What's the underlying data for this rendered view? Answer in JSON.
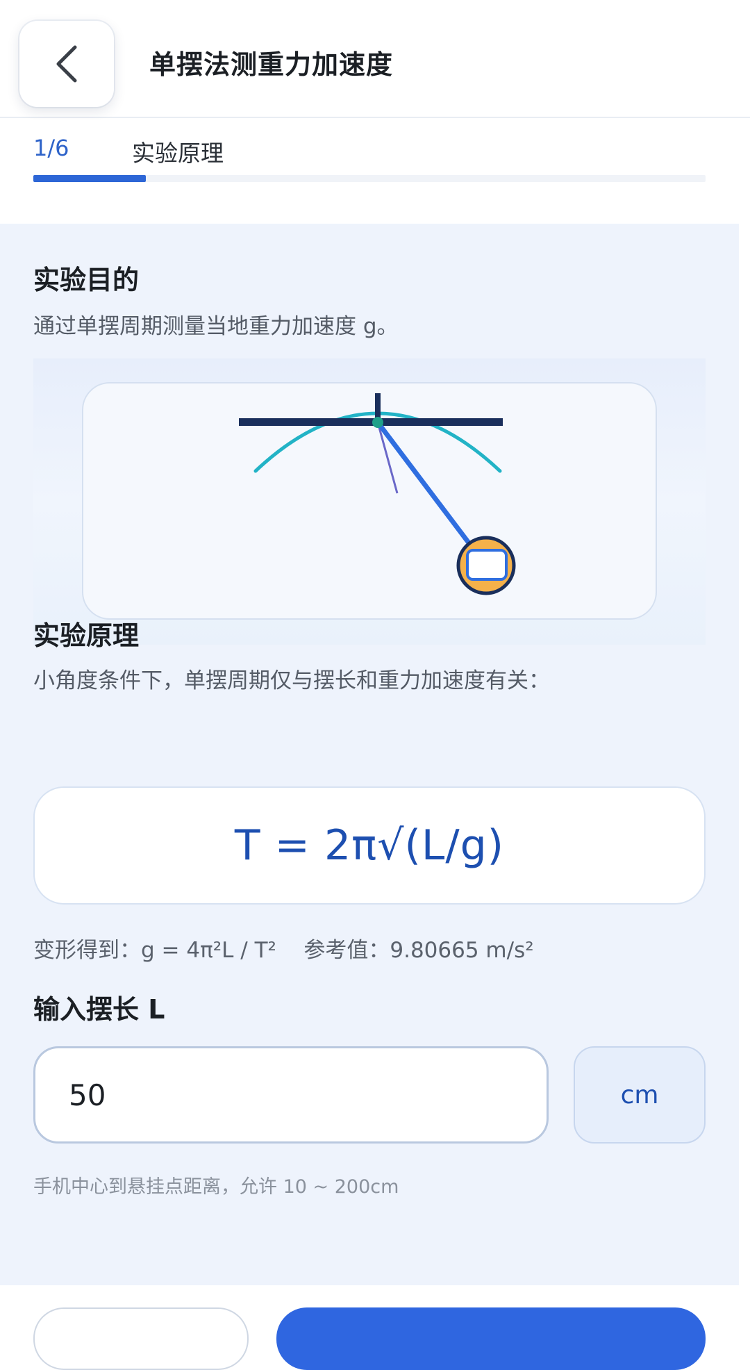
{
  "header": {
    "title": "单摆法测重力加速度",
    "back_icon": "chevron-left-icon"
  },
  "steps": {
    "current_label": "1/6",
    "name": "实验原理",
    "progress": 0.167
  },
  "purpose": {
    "title": "实验目的",
    "text": "通过单摆周期测量当地重力加速度 g。"
  },
  "principle": {
    "title": "实验原理",
    "text": "小角度条件下，单摆周期仅与摆长和重力加速度有关：",
    "formula": "T = 2π√(L/g)",
    "derived": "变形得到：g = 4π²L / T²    参考值：9.80665 m/s²"
  },
  "length_input": {
    "label": "输入摆长 L",
    "value": "50",
    "unit": "cm",
    "hint": "手机中心到悬挂点距离，允许 10 ~ 200cm"
  },
  "colors": {
    "accent": "#2d66d6",
    "formula": "#1d4fb0",
    "background": "#eef3fc",
    "bob_fill": "#f5b14a",
    "frame": "#1a2f5c",
    "arc": "#22b3c6"
  }
}
